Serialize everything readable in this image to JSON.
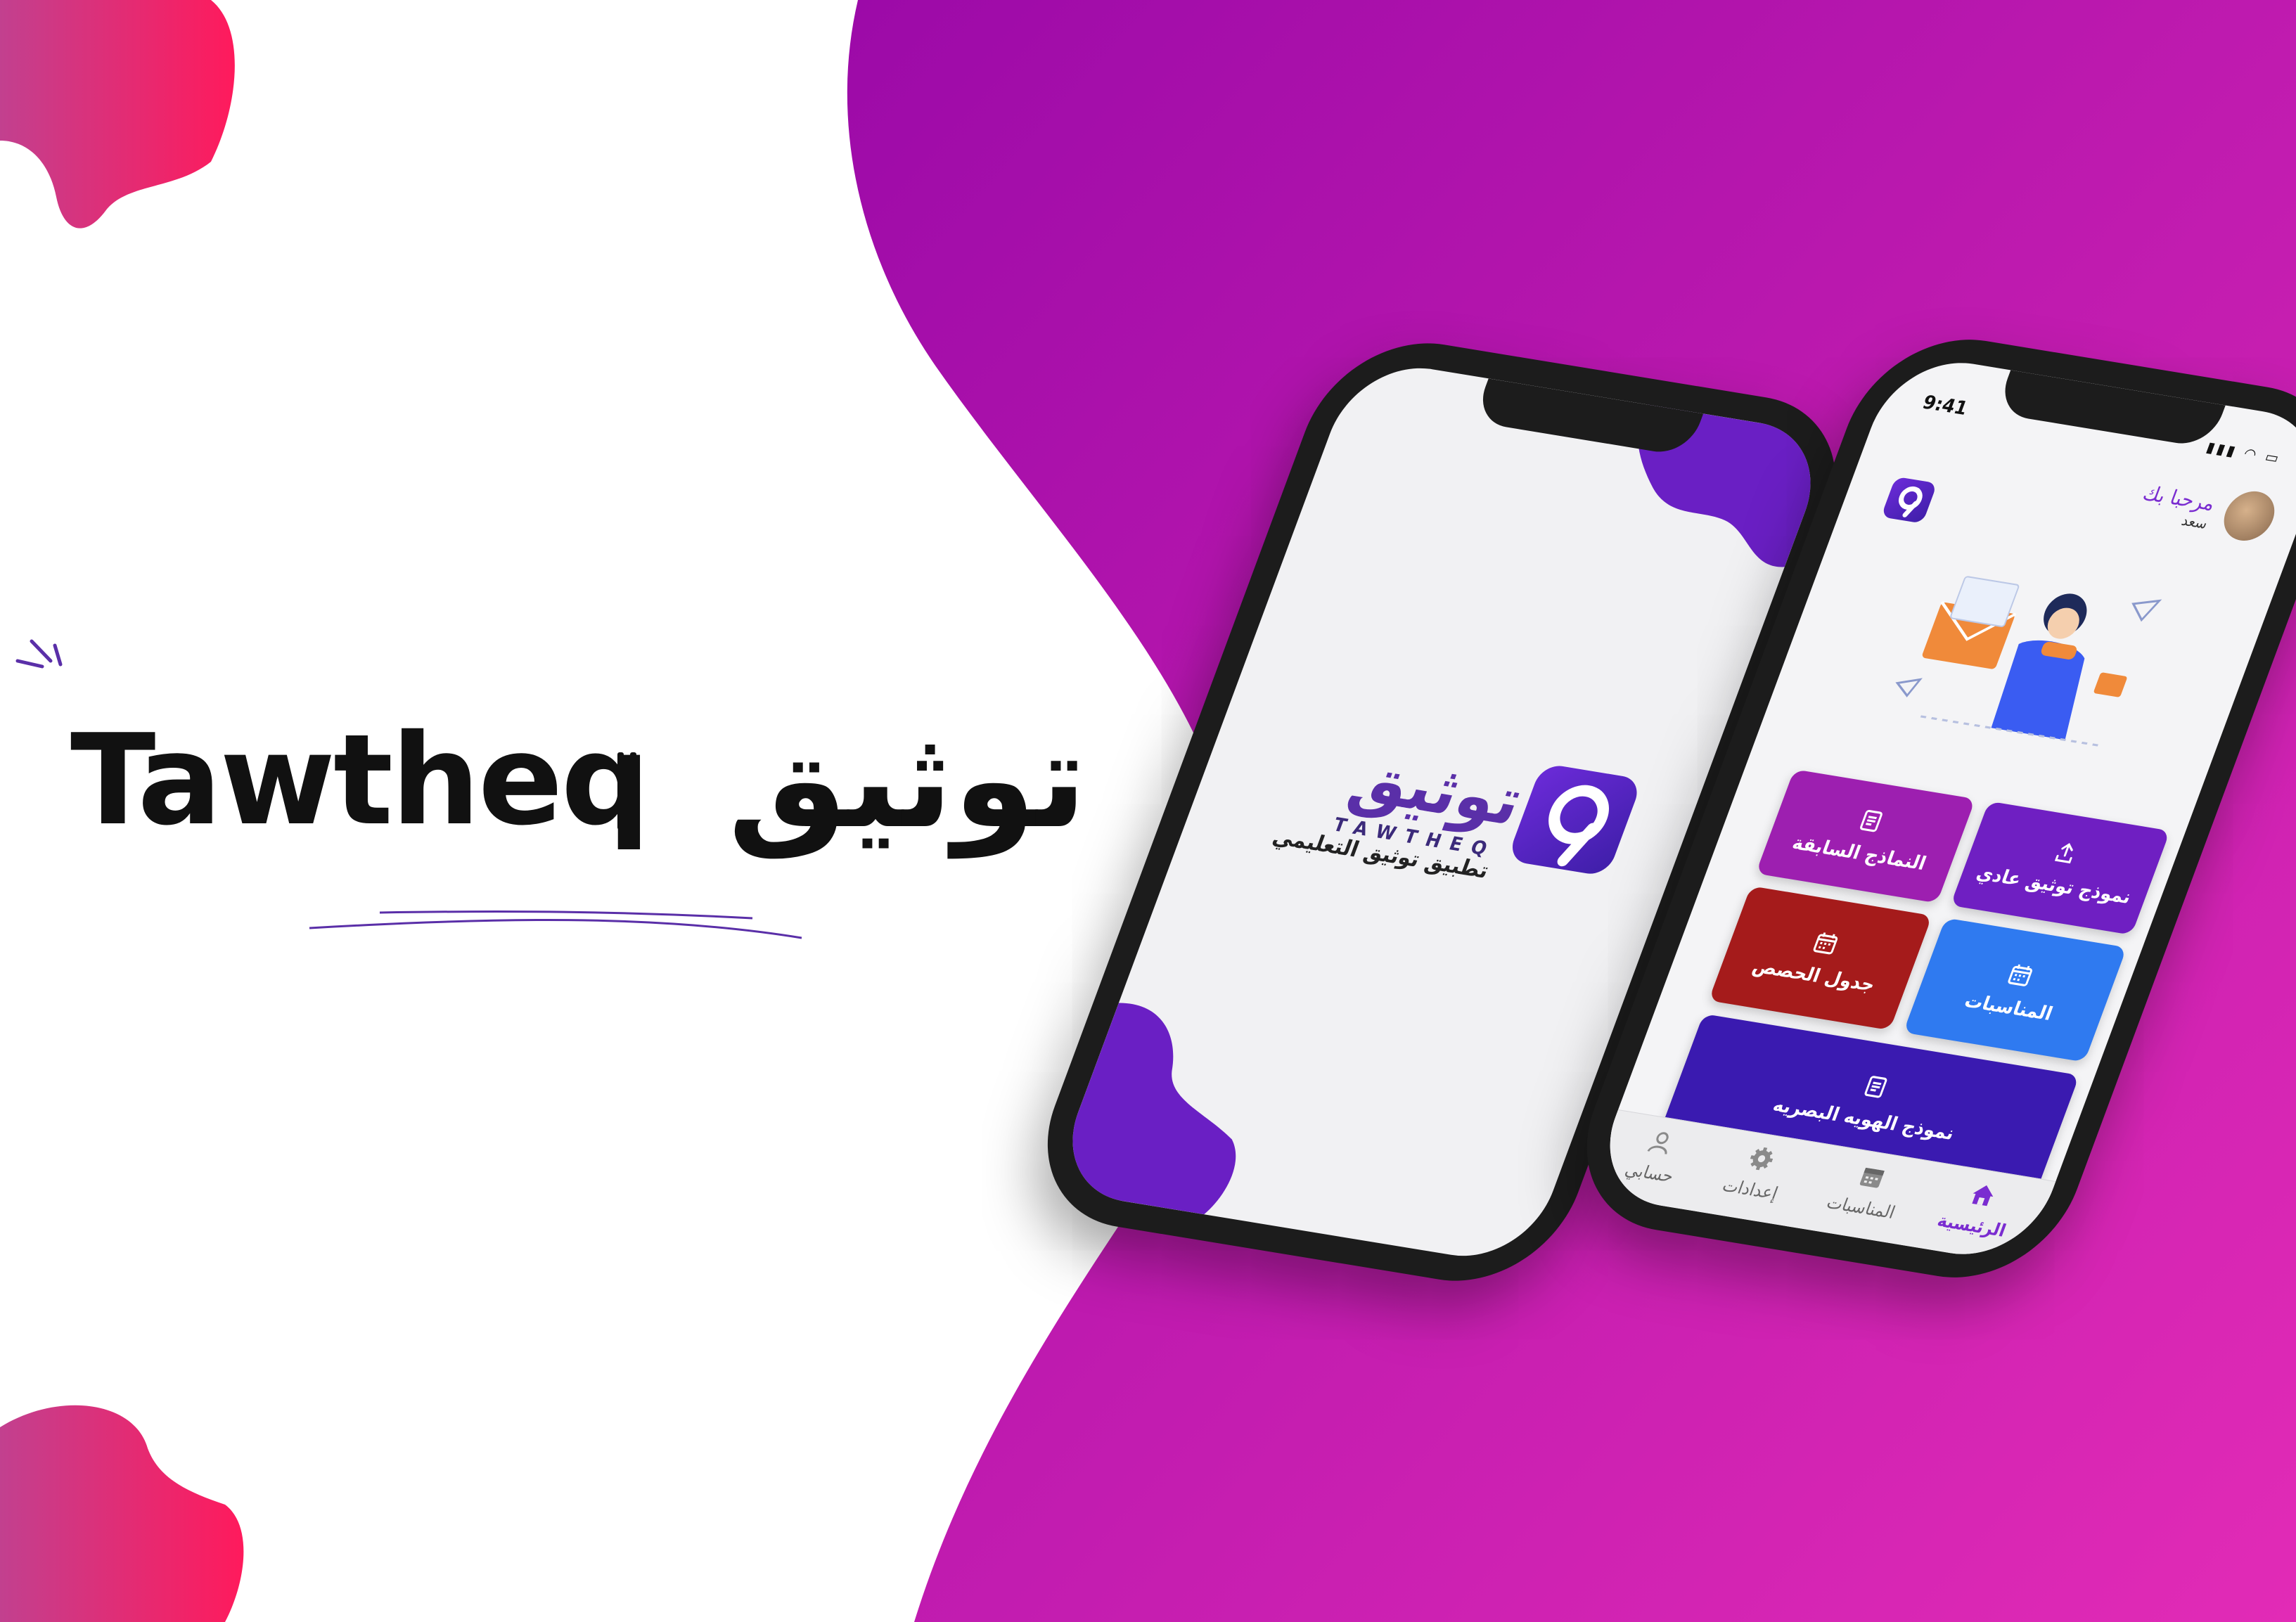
{
  "brand": {
    "arabic_name": "توثيق",
    "english_name": "Tawtheq"
  },
  "colors": {
    "gradient_start": "#9c0aa8",
    "gradient_end": "#e22bb6",
    "blob_start": "#c2408f",
    "blob_end": "#ff1a5c",
    "accent_purple": "#6f1fc2",
    "tile_magenta": "#9d1fb0",
    "tile_blue": "#2f7af0",
    "tile_red": "#a51b1b",
    "tile_indigo": "#3a1ab0"
  },
  "splash": {
    "logo_arabic": "توثيق",
    "logo_english": "TAWTHEQ",
    "logo_subtitle": "تطبيق توثيق التعليمي"
  },
  "home": {
    "status_time": "9:41",
    "greeting": "مرحبا بك",
    "user_name": "سعد",
    "tiles": [
      {
        "label": "نموذج توثيق عادي",
        "icon": "upload-icon"
      },
      {
        "label": "النماذج السابقة",
        "icon": "document-icon"
      },
      {
        "label": "المناسبات",
        "icon": "calendar-icon"
      },
      {
        "label": "جدول الحصص",
        "icon": "calendar-icon"
      },
      {
        "label": "نموذج الهويه البصريه",
        "icon": "document-icon"
      }
    ],
    "support_icon": "support-agent-icon",
    "tabbar": [
      {
        "label": "الرئيسية",
        "icon": "home-icon",
        "active": true
      },
      {
        "label": "المناسبات",
        "icon": "calendar-icon",
        "active": false
      },
      {
        "label": "إعدادات",
        "icon": "gear-icon",
        "active": false
      },
      {
        "label": "حسابي",
        "icon": "user-icon",
        "active": false
      }
    ]
  }
}
